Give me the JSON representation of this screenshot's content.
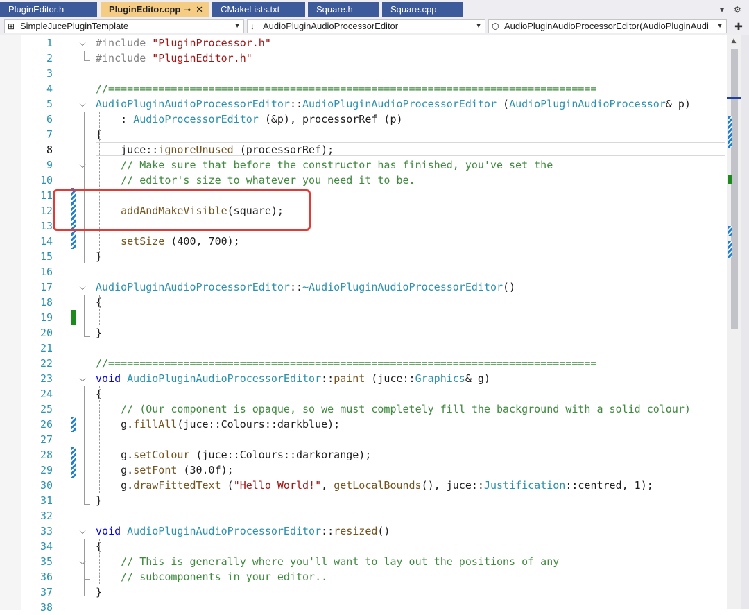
{
  "tabs": [
    {
      "label": "PluginEditor.h",
      "active": false
    },
    {
      "label": "PluginEditor.cpp",
      "active": true,
      "pin": "⊸",
      "close": "✕"
    },
    {
      "label": "CMakeLists.txt",
      "active": false
    },
    {
      "label": "Square.h",
      "active": false
    },
    {
      "label": "Square.cpp",
      "active": false
    }
  ],
  "tab_controls": {
    "dropdown": "▾",
    "settings": "⚙"
  },
  "navbar": {
    "project": "SimpleJucePluginTemplate",
    "scope": "AudioPluginAudioProcessorEditor",
    "member": "AudioPluginAudioProcessorEditor(AudioPluginAudi",
    "split": "✚"
  },
  "icons": {
    "project": "project-icon",
    "scope": "down-arrow-icon",
    "member": "method-cube-icon",
    "split": "split-window-icon"
  },
  "colors": {
    "tab_inactive": "#3d5a9a",
    "tab_active": "#f5cc84",
    "highlight": "#e53935",
    "change_saved": "#1c8a1c",
    "change_unsaved": "#1f7fd0"
  },
  "editor": {
    "current_line": 8,
    "lines": [
      {
        "n": "1",
        "t": "#include \"PluginProcessor.h\""
      },
      {
        "n": "2",
        "t": "#include \"PluginEditor.h\""
      },
      {
        "n": "3",
        "t": ""
      },
      {
        "n": "4",
        "t": "//=============================================================================="
      },
      {
        "n": "5",
        "t": "AudioPluginAudioProcessorEditor::AudioPluginAudioProcessorEditor (AudioPluginAudioProcessor& p)"
      },
      {
        "n": "6",
        "t": "    : AudioProcessorEditor (&p), processorRef (p)"
      },
      {
        "n": "7",
        "t": "{"
      },
      {
        "n": "8",
        "t": "    juce::ignoreUnused (processorRef);"
      },
      {
        "n": "9",
        "t": "    // Make sure that before the constructor has finished, you've set the"
      },
      {
        "n": "10",
        "t": "    // editor's size to whatever you need it to be."
      },
      {
        "n": "11",
        "t": ""
      },
      {
        "n": "12",
        "t": "    addAndMakeVisible(square);"
      },
      {
        "n": "13",
        "t": ""
      },
      {
        "n": "14",
        "t": "    setSize (400, 700);"
      },
      {
        "n": "15",
        "t": "}"
      },
      {
        "n": "16",
        "t": ""
      },
      {
        "n": "17",
        "t": "AudioPluginAudioProcessorEditor::~AudioPluginAudioProcessorEditor()"
      },
      {
        "n": "18",
        "t": "{"
      },
      {
        "n": "19",
        "t": ""
      },
      {
        "n": "20",
        "t": "}"
      },
      {
        "n": "21",
        "t": ""
      },
      {
        "n": "22",
        "t": "//=============================================================================="
      },
      {
        "n": "23",
        "t": "void AudioPluginAudioProcessorEditor::paint (juce::Graphics& g)"
      },
      {
        "n": "24",
        "t": "{"
      },
      {
        "n": "25",
        "t": "    // (Our component is opaque, so we must completely fill the background with a solid colour)"
      },
      {
        "n": "26",
        "t": "    g.fillAll(juce::Colours::darkblue);"
      },
      {
        "n": "27",
        "t": ""
      },
      {
        "n": "28",
        "t": "    g.setColour (juce::Colours::darkorange);"
      },
      {
        "n": "29",
        "t": "    g.setFont (30.0f);"
      },
      {
        "n": "30",
        "t": "    g.drawFittedText (\"Hello World!\", getLocalBounds(), juce::Justification::centred, 1);"
      },
      {
        "n": "31",
        "t": "}"
      },
      {
        "n": "32",
        "t": ""
      },
      {
        "n": "33",
        "t": "void AudioPluginAudioProcessorEditor::resized()"
      },
      {
        "n": "34",
        "t": "{"
      },
      {
        "n": "35",
        "t": "    // This is generally where you'll want to lay out the positions of any"
      },
      {
        "n": "36",
        "t": "    // subcomponents in your editor.."
      },
      {
        "n": "37",
        "t": "}"
      },
      {
        "n": "38",
        "t": ""
      }
    ]
  }
}
